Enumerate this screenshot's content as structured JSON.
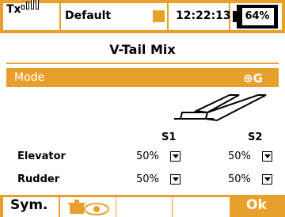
{
  "status": {
    "tx_label": "Tx",
    "model_name": "Default",
    "time": "12:22:13",
    "battery": "64%"
  },
  "screen": {
    "title": "V-Tail Mix"
  },
  "mode": {
    "label": "Mode",
    "icon": "⊕G"
  },
  "table": {
    "columns": [
      "S1",
      "S2"
    ],
    "rows": [
      {
        "label": "Elevator",
        "s1": "50%",
        "s2": "50%"
      },
      {
        "label": "Rudder",
        "s1": "50%",
        "s2": "50%"
      }
    ]
  },
  "bottom": {
    "sym": "Sym.",
    "ok": "Ok"
  },
  "colors": {
    "accent": "#e8a02c",
    "background": "#ffffff",
    "text": "#000000"
  },
  "icons": [
    "signal-bars-icon",
    "battery-icon",
    "gyro-mode-icon",
    "v-tail-diagram-icon",
    "servo-view-icon",
    "dropdown-arrow-icon"
  ]
}
